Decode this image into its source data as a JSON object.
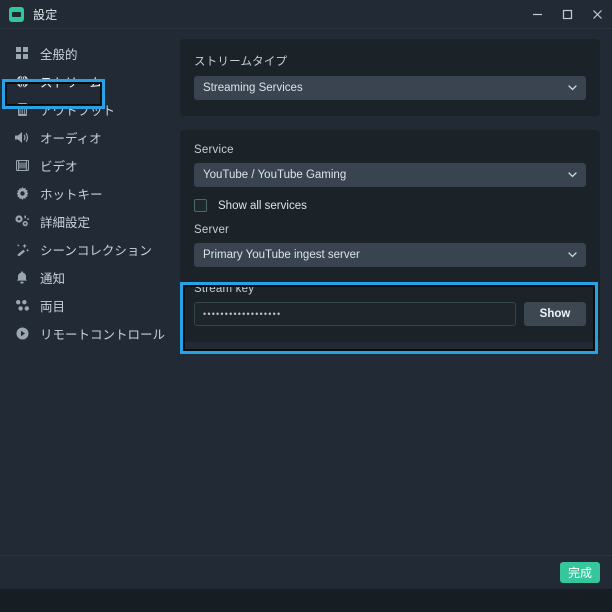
{
  "window": {
    "title": "設定",
    "app_icon": "settings-app-icon",
    "controls": [
      {
        "name": "minimize",
        "glyph": "minimize-icon"
      },
      {
        "name": "maximize",
        "glyph": "maximize-icon"
      },
      {
        "name": "close",
        "glyph": "close-icon"
      }
    ]
  },
  "sidebar": {
    "items": [
      {
        "label": "全般的",
        "icon": "grid-icon",
        "active": false
      },
      {
        "label": "ストリーム",
        "icon": "globe-icon",
        "active": true
      },
      {
        "label": "アウトプット",
        "icon": "server-icon",
        "active": false
      },
      {
        "label": "オーディオ",
        "icon": "speaker-icon",
        "active": false
      },
      {
        "label": "ビデオ",
        "icon": "film-icon",
        "active": false
      },
      {
        "label": "ホットキー",
        "icon": "gear-icon",
        "active": false
      },
      {
        "label": "詳細設定",
        "icon": "sliders-icon",
        "active": false
      },
      {
        "label": "シーンコレクション",
        "icon": "wand-icon",
        "active": false
      },
      {
        "label": "通知",
        "icon": "bell-icon",
        "active": false
      },
      {
        "label": "両目",
        "icon": "dots-grid-icon",
        "active": false
      },
      {
        "label": "リモートコントロール",
        "icon": "play-circle-icon",
        "active": false
      }
    ]
  },
  "main": {
    "stream_type": {
      "label": "ストリームタイプ",
      "value": "Streaming Services",
      "chevron": "chevron-down-icon"
    },
    "service": {
      "label": "Service",
      "value": "YouTube / YouTube Gaming",
      "chevron": "chevron-down-icon"
    },
    "show_all_services": {
      "label": "Show all services",
      "checked": false
    },
    "server": {
      "label": "Server",
      "value": "Primary YouTube ingest server",
      "chevron": "chevron-down-icon"
    },
    "stream_key": {
      "label": "Stream key",
      "value": "••••••••••••••••••",
      "placeholder": "",
      "show_button_label": "Show"
    }
  },
  "footer": {
    "done_label": "完成"
  },
  "highlights": {
    "accent_color": "#27a2e6",
    "targets": [
      "sidebar-item-stream",
      "stream-key-group"
    ]
  },
  "colors": {
    "window_bg": "#222b35",
    "card_bg": "#1b2228",
    "select_bg": "#394450",
    "accent_blue": "#27a2e6",
    "done_green": "#35c79b",
    "footer_strip": "#161e24"
  }
}
